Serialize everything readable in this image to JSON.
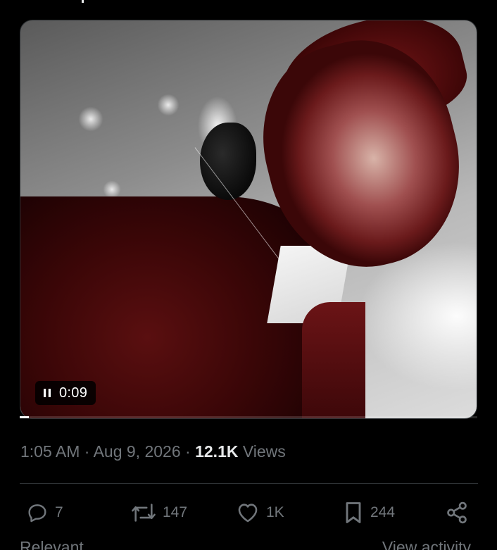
{
  "video": {
    "timestamp": "0:09",
    "state_icon": "pause-icon",
    "progress": 0.02
  },
  "tweet_meta": {
    "time": "1:05 AM",
    "separator": "·",
    "date": "Aug 9, 2026",
    "views_count": "12.1K",
    "views_label": "Views"
  },
  "actions": {
    "reply": {
      "icon": "reply-icon",
      "count": "7"
    },
    "repost": {
      "icon": "repost-icon",
      "count": "147"
    },
    "like": {
      "icon": "heart-icon",
      "count": "1K"
    },
    "bookmark": {
      "icon": "bookmark-icon",
      "count": "244"
    },
    "share": {
      "icon": "share-icon"
    }
  },
  "replies_header": {
    "sort_label": "Relevant",
    "activity_link": "View activity"
  },
  "colors": {
    "background": "#000000",
    "text_primary": "#e7e9ea",
    "text_secondary": "#71767b",
    "border": "#2f3336"
  }
}
